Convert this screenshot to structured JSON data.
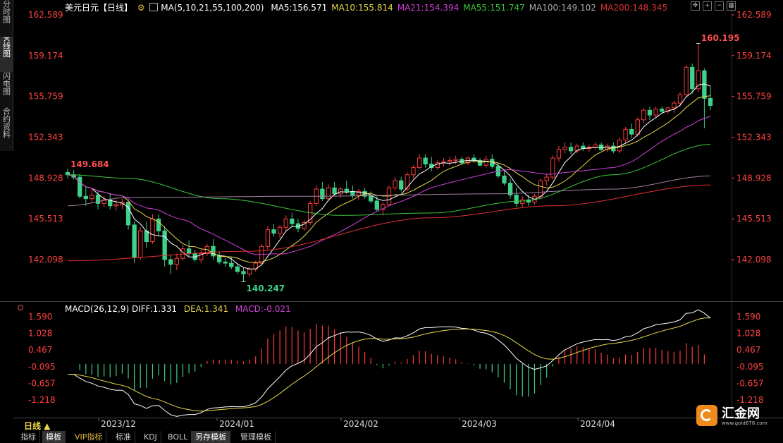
{
  "side_tabs": [
    "分时图",
    "K线图",
    "闪电图",
    "合约资料"
  ],
  "main_header": {
    "title": "美元日元【日线】",
    "ma_params": "MA(5,10,21,55,100,200)",
    "ma_values": [
      {
        "label": "MA5:156.571",
        "color": "#ffffff"
      },
      {
        "label": "MA10:155.814",
        "color": "#e8d84a"
      },
      {
        "label": "MA21:154.394",
        "color": "#d040d8"
      },
      {
        "label": "MA55:151.747",
        "color": "#3cc83c"
      },
      {
        "label": "MA100:149.102",
        "color": "#aaaaaa"
      },
      {
        "label": "MA200:148.345",
        "color": "#e03030"
      }
    ]
  },
  "macd_header": {
    "label": "MACD(26,12,9)",
    "diff": "DIFF:1.331",
    "dea": "DEA:1.341",
    "macd": "MACD:-0.021"
  },
  "price_axis": [
    "162.589",
    "159.174",
    "155.759",
    "152.343",
    "148.928",
    "145.513",
    "142.098"
  ],
  "macd_axis": [
    "1.590",
    "1.028",
    "0.467",
    "-0.095",
    "-0.657",
    "-1.218"
  ],
  "date_axis": [
    "2023/12",
    "2024/01",
    "2024/02",
    "2024/03",
    "2024/04"
  ],
  "annotations": {
    "high": "160.195",
    "low": "140.247",
    "start": "149.684"
  },
  "period_label": "日线 ▲",
  "bottom_tabs": [
    "指标",
    "模板",
    "VIP指标",
    "标准",
    "KDJ",
    "BOLL",
    "另存模板",
    "管理模板"
  ],
  "logo": {
    "name": "汇金网",
    "url": "www.gold678.com"
  },
  "colors": {
    "up": "#ff3b3b",
    "down": "#3fd08a",
    "axis_red": "#ff4040",
    "bg": "#000000"
  },
  "chart_data": [
    {
      "type": "candlestick",
      "title": "美元日元【日线】",
      "ylim": [
        140.0,
        163.5
      ],
      "y_ticks": [
        162.589,
        159.174,
        155.759,
        152.343,
        148.928,
        145.513,
        142.098
      ],
      "x_tick_labels": [
        "2023/12",
        "2024/01",
        "2024/02",
        "2024/03",
        "2024/04"
      ],
      "ohlc": [
        [
          149.4,
          149.7,
          148.9,
          149.2
        ],
        [
          149.2,
          149.6,
          148.8,
          149.0
        ],
        [
          149.0,
          149.3,
          147.2,
          147.4
        ],
        [
          147.4,
          148.2,
          146.6,
          147.2
        ],
        [
          147.2,
          148.0,
          146.9,
          147.5
        ],
        [
          147.5,
          147.8,
          146.3,
          146.8
        ],
        [
          146.8,
          147.4,
          146.5,
          147.1
        ],
        [
          147.1,
          147.6,
          146.3,
          146.6
        ],
        [
          146.6,
          147.1,
          146.2,
          146.7
        ],
        [
          146.7,
          147.2,
          146.3,
          146.9
        ],
        [
          146.9,
          147.0,
          144.6,
          145.0
        ],
        [
          145.0,
          145.3,
          141.8,
          142.3
        ],
        [
          142.3,
          144.8,
          142.1,
          144.5
        ],
        [
          144.5,
          145.3,
          143.1,
          143.6
        ],
        [
          143.6,
          145.9,
          143.4,
          145.5
        ],
        [
          145.5,
          145.9,
          144.1,
          144.5
        ],
        [
          144.5,
          144.9,
          141.5,
          142.1
        ],
        [
          142.1,
          142.5,
          140.9,
          141.7
        ],
        [
          141.7,
          142.6,
          141.2,
          142.2
        ],
        [
          142.2,
          143.3,
          142.0,
          143.0
        ],
        [
          143.0,
          143.7,
          142.4,
          142.6
        ],
        [
          142.6,
          142.9,
          141.9,
          142.1
        ],
        [
          142.1,
          142.9,
          141.8,
          142.6
        ],
        [
          142.6,
          143.4,
          142.4,
          143.2
        ],
        [
          143.2,
          143.8,
          142.1,
          142.4
        ],
        [
          142.4,
          142.8,
          141.7,
          141.9
        ],
        [
          141.9,
          142.2,
          141.5,
          141.8
        ],
        [
          141.8,
          142.3,
          141.3,
          141.5
        ],
        [
          141.5,
          141.8,
          140.9,
          141.1
        ],
        [
          141.1,
          141.4,
          140.247,
          140.9
        ],
        [
          140.9,
          141.5,
          140.7,
          141.3
        ],
        [
          141.3,
          142.0,
          141.1,
          141.8
        ],
        [
          141.8,
          143.4,
          141.7,
          143.2
        ],
        [
          143.2,
          144.9,
          142.9,
          144.6
        ],
        [
          144.6,
          145.1,
          144.0,
          144.3
        ],
        [
          144.3,
          145.0,
          143.9,
          144.8
        ],
        [
          144.8,
          145.8,
          144.5,
          145.5
        ],
        [
          145.5,
          146.0,
          144.8,
          145.1
        ],
        [
          145.1,
          145.5,
          144.4,
          144.7
        ],
        [
          144.7,
          145.4,
          144.5,
          145.2
        ],
        [
          145.2,
          147.0,
          145.0,
          146.8
        ],
        [
          146.8,
          148.3,
          146.6,
          148.0
        ],
        [
          148.0,
          148.6,
          147.0,
          147.2
        ],
        [
          147.2,
          148.4,
          147.0,
          148.1
        ],
        [
          148.1,
          148.6,
          147.4,
          147.6
        ],
        [
          147.6,
          148.2,
          147.3,
          148.0
        ],
        [
          148.0,
          148.7,
          147.6,
          147.8
        ],
        [
          147.8,
          148.3,
          147.2,
          147.5
        ],
        [
          147.5,
          148.0,
          147.1,
          147.8
        ],
        [
          147.8,
          148.1,
          147.2,
          147.4
        ],
        [
          147.4,
          147.8,
          146.8,
          147.0
        ],
        [
          147.0,
          147.4,
          146.1,
          146.3
        ],
        [
          146.3,
          146.9,
          145.8,
          146.7
        ],
        [
          146.7,
          148.3,
          146.6,
          148.1
        ],
        [
          148.1,
          149.0,
          147.9,
          148.7
        ],
        [
          148.7,
          149.0,
          147.8,
          148.0
        ],
        [
          148.0,
          149.4,
          147.8,
          149.2
        ],
        [
          149.2,
          150.0,
          148.9,
          149.8
        ],
        [
          149.8,
          150.9,
          149.7,
          150.6
        ],
        [
          150.6,
          150.9,
          149.8,
          150.1
        ],
        [
          150.1,
          150.7,
          149.5,
          149.8
        ],
        [
          149.8,
          150.4,
          149.6,
          150.2
        ],
        [
          150.2,
          150.6,
          149.9,
          150.3
        ],
        [
          150.3,
          150.7,
          150.0,
          150.4
        ],
        [
          150.4,
          150.8,
          150.1,
          150.5
        ],
        [
          150.5,
          150.7,
          150.0,
          150.2
        ],
        [
          150.2,
          150.7,
          150.0,
          150.6
        ],
        [
          150.6,
          150.9,
          150.2,
          150.4
        ],
        [
          150.4,
          150.6,
          149.9,
          150.0
        ],
        [
          150.0,
          150.8,
          149.8,
          150.5
        ],
        [
          150.5,
          150.9,
          149.7,
          149.9
        ],
        [
          149.9,
          150.2,
          148.9,
          149.1
        ],
        [
          149.1,
          149.6,
          148.3,
          148.5
        ],
        [
          148.5,
          148.9,
          147.2,
          147.5
        ],
        [
          147.5,
          148.1,
          146.5,
          146.8
        ],
        [
          146.8,
          147.4,
          146.5,
          147.1
        ],
        [
          147.1,
          147.5,
          146.6,
          146.9
        ],
        [
          146.9,
          147.6,
          146.7,
          147.4
        ],
        [
          147.4,
          148.9,
          147.2,
          148.7
        ],
        [
          148.7,
          149.3,
          148.3,
          149.0
        ],
        [
          149.0,
          150.8,
          148.8,
          150.6
        ],
        [
          150.6,
          151.6,
          150.3,
          151.3
        ],
        [
          151.3,
          151.9,
          151.0,
          151.5
        ],
        [
          151.5,
          151.9,
          150.9,
          151.2
        ],
        [
          151.2,
          151.8,
          151.0,
          151.6
        ],
        [
          151.6,
          151.9,
          151.2,
          151.4
        ],
        [
          151.4,
          151.7,
          151.1,
          151.5
        ],
        [
          151.5,
          151.9,
          151.3,
          151.7
        ],
        [
          151.7,
          151.9,
          151.2,
          151.3
        ],
        [
          151.3,
          151.8,
          151.1,
          151.6
        ],
        [
          151.6,
          151.9,
          151.0,
          151.2
        ],
        [
          151.2,
          152.3,
          151.0,
          152.1
        ],
        [
          152.1,
          153.2,
          151.9,
          153.0
        ],
        [
          153.0,
          153.5,
          152.3,
          152.6
        ],
        [
          152.6,
          154.0,
          152.4,
          153.8
        ],
        [
          153.8,
          154.8,
          153.5,
          154.6
        ],
        [
          154.6,
          154.9,
          153.8,
          154.2
        ],
        [
          154.2,
          154.9,
          154.0,
          154.7
        ],
        [
          154.7,
          154.9,
          154.3,
          154.5
        ],
        [
          154.5,
          154.9,
          154.3,
          154.8
        ],
        [
          154.8,
          155.4,
          154.4,
          155.2
        ],
        [
          155.2,
          156.1,
          154.9,
          155.9
        ],
        [
          155.9,
          158.4,
          155.7,
          158.2
        ],
        [
          158.2,
          158.5,
          156.0,
          156.4
        ],
        [
          156.4,
          160.195,
          156.1,
          157.9
        ],
        [
          157.9,
          158.1,
          153.1,
          155.6
        ],
        [
          155.6,
          156.6,
          154.6,
          155.0
        ]
      ],
      "indicator_series": [
        {
          "name": "MA5"
        },
        {
          "name": "MA10"
        },
        {
          "name": "MA21"
        },
        {
          "name": "MA55"
        },
        {
          "name": "MA100"
        },
        {
          "name": "MA200"
        }
      ]
    },
    {
      "type": "bar",
      "title": "MACD(26,12,9)",
      "ylim": [
        -1.45,
        1.7
      ],
      "y_ticks": [
        1.59,
        1.028,
        0.467,
        -0.095,
        -0.657,
        -1.218
      ],
      "series": [
        {
          "name": "DIFF"
        },
        {
          "name": "DEA"
        },
        {
          "name": "MACD"
        }
      ]
    }
  ]
}
